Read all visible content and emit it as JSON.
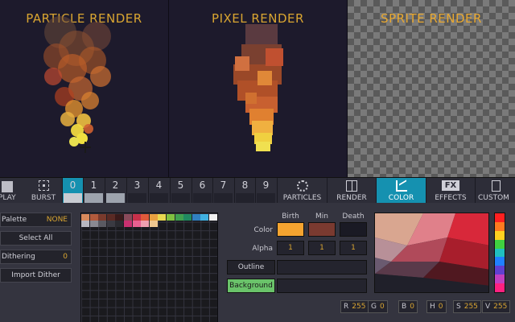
{
  "panels": {
    "particle_title": "PARTICLE RENDER",
    "pixel_title": "PIXEL RENDER",
    "sprite_title": "SPRITE RENDER"
  },
  "toolbar": {
    "play_label": "PLAY",
    "burst_label": "BURST",
    "slots": [
      "0",
      "1",
      "2",
      "3",
      "4",
      "5",
      "6",
      "7",
      "8",
      "9"
    ],
    "active_slot": "0",
    "tabs": {
      "particles": "PARTICLES",
      "render": "RENDER",
      "color": "COLOR",
      "effects": "EFFECTS",
      "custom": "CUSTOM",
      "fx_glyph": "FX"
    }
  },
  "sidebar": {
    "palette_label": "Palette",
    "palette_value": "NONE",
    "select_all": "Select All",
    "dithering_label": "Dithering",
    "dithering_value": "0",
    "import_dither": "Import Dither"
  },
  "color_panel": {
    "headers": {
      "birth": "Birth",
      "min": "Min",
      "death": "Death"
    },
    "color_label": "Color",
    "alpha_label": "Alpha",
    "birth_color": "#f5a430",
    "min_color": "#7a3a30",
    "death_color": "#1a1a24",
    "alpha_values": [
      "1",
      "1",
      "1"
    ],
    "outline_label": "Outline",
    "background_label": "Background"
  },
  "channels": [
    {
      "k": "R",
      "v": "255"
    },
    {
      "k": "G",
      "v": "0"
    },
    {
      "k": "B",
      "v": "0"
    },
    {
      "k": "H",
      "v": "0"
    },
    {
      "k": "S",
      "v": "255"
    },
    {
      "k": "V",
      "v": "255"
    }
  ],
  "palette_swatches": [
    "#d98a5c",
    "#b35a3c",
    "#7a3a2c",
    "#5a2a24",
    "#3a1a1a",
    "#8a4a5a",
    "#c8304a",
    "#e05a3a",
    "#e8a040",
    "#e8d850",
    "#80c040",
    "#40a050",
    "#208a60",
    "#3080c0",
    "#40b0e0",
    "#f0f0f0",
    "#b8b8c0",
    "#8a8a92",
    "#5a5a62",
    "#3a3a42",
    "#2a2a30",
    "#c83070",
    "#e86090",
    "#f0a0b0",
    "#f0c890"
  ],
  "hue_colors": [
    "#ff2020",
    "#ff7a20",
    "#ffd020",
    "#40d040",
    "#20c0c0",
    "#2080ff",
    "#6040d0",
    "#c040c0",
    "#ff2080"
  ]
}
